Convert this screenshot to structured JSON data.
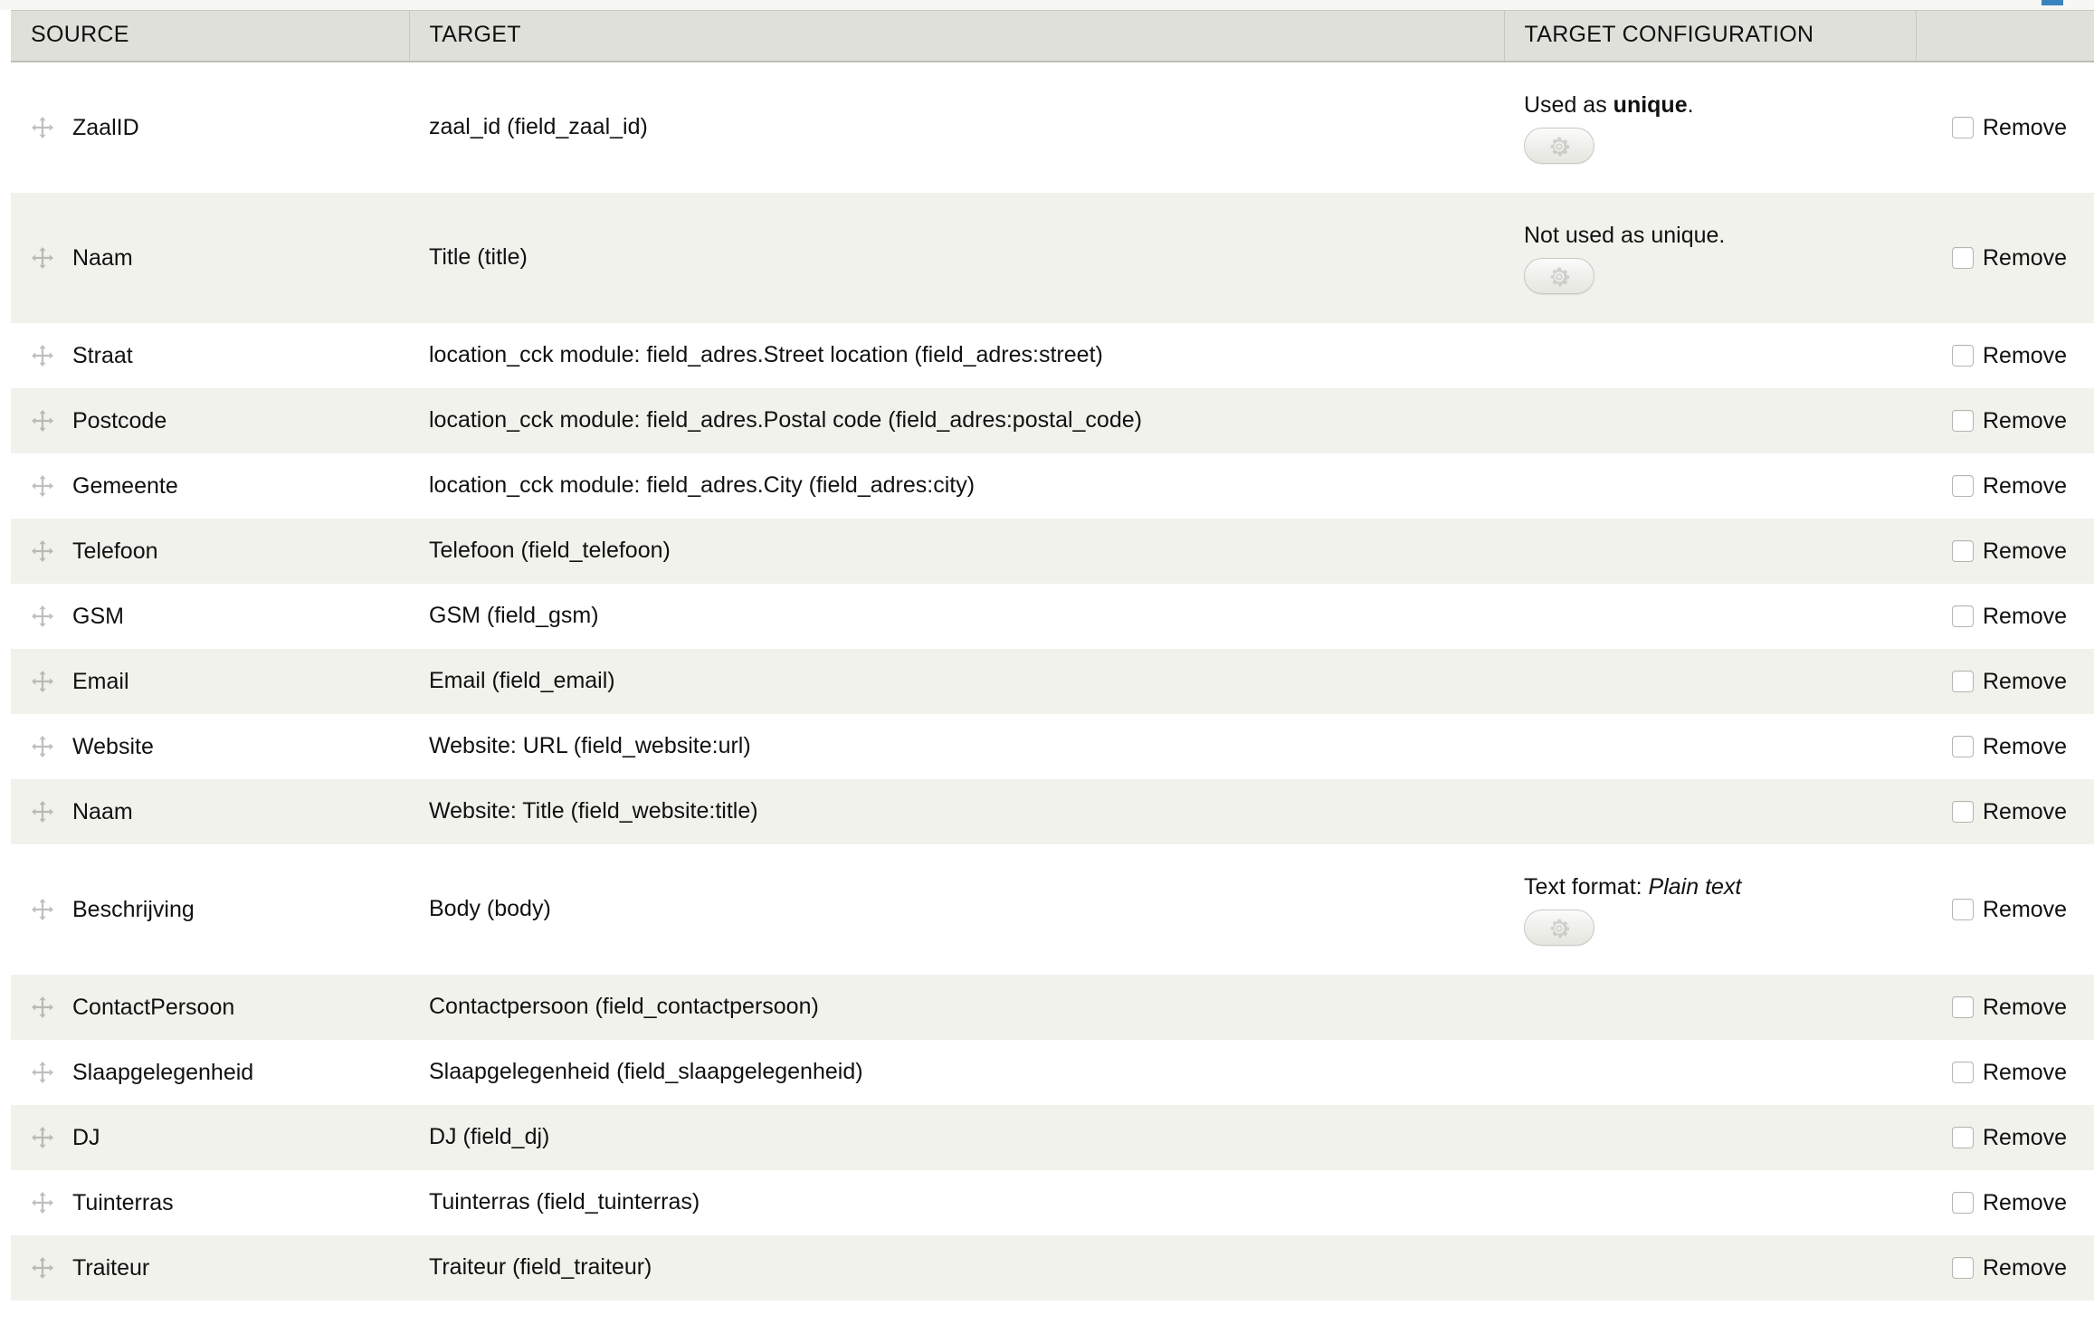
{
  "top_fragment_color": "#3a84bd",
  "table": {
    "headers": {
      "source": "SOURCE",
      "target": "TARGET",
      "target_configuration": "TARGET CONFIGURATION",
      "actions": ""
    },
    "remove_label": "Remove",
    "rows": [
      {
        "source": "ZaalID",
        "target": "zaal_id (field_zaal_id)",
        "config_prefix": "Used as ",
        "config_strong": "unique",
        "config_suffix": ".",
        "config_italic": "",
        "has_gear": true,
        "remove": "Remove",
        "tall": true
      },
      {
        "source": "Naam",
        "target": "Title (title)",
        "config_prefix": "Not used as unique.",
        "config_strong": "",
        "config_suffix": "",
        "config_italic": "",
        "has_gear": true,
        "remove": "Remove",
        "tall": true
      },
      {
        "source": "Straat",
        "target": "location_cck module: field_adres.Street location (field_adres:street)",
        "config_prefix": "",
        "config_strong": "",
        "config_suffix": "",
        "config_italic": "",
        "has_gear": false,
        "remove": "Remove",
        "tall": false
      },
      {
        "source": "Postcode",
        "target": "location_cck module: field_adres.Postal code (field_adres:postal_code)",
        "config_prefix": "",
        "config_strong": "",
        "config_suffix": "",
        "config_italic": "",
        "has_gear": false,
        "remove": "Remove",
        "tall": false
      },
      {
        "source": "Gemeente",
        "target": "location_cck module: field_adres.City (field_adres:city)",
        "config_prefix": "",
        "config_strong": "",
        "config_suffix": "",
        "config_italic": "",
        "has_gear": false,
        "remove": "Remove",
        "tall": false
      },
      {
        "source": "Telefoon",
        "target": "Telefoon (field_telefoon)",
        "config_prefix": "",
        "config_strong": "",
        "config_suffix": "",
        "config_italic": "",
        "has_gear": false,
        "remove": "Remove",
        "tall": false
      },
      {
        "source": "GSM",
        "target": "GSM (field_gsm)",
        "config_prefix": "",
        "config_strong": "",
        "config_suffix": "",
        "config_italic": "",
        "has_gear": false,
        "remove": "Remove",
        "tall": false
      },
      {
        "source": "Email",
        "target": "Email (field_email)",
        "config_prefix": "",
        "config_strong": "",
        "config_suffix": "",
        "config_italic": "",
        "has_gear": false,
        "remove": "Remove",
        "tall": false
      },
      {
        "source": "Website",
        "target": "Website: URL (field_website:url)",
        "config_prefix": "",
        "config_strong": "",
        "config_suffix": "",
        "config_italic": "",
        "has_gear": false,
        "remove": "Remove",
        "tall": false
      },
      {
        "source": "Naam",
        "target": "Website: Title (field_website:title)",
        "config_prefix": "",
        "config_strong": "",
        "config_suffix": "",
        "config_italic": "",
        "has_gear": false,
        "remove": "Remove",
        "tall": false
      },
      {
        "source": "Beschrijving",
        "target": "Body (body)",
        "config_prefix": "Text format: ",
        "config_strong": "",
        "config_suffix": "",
        "config_italic": "Plain text",
        "has_gear": true,
        "remove": "Remove",
        "tall": true
      },
      {
        "source": "ContactPersoon",
        "target": "Contactpersoon (field_contactpersoon)",
        "config_prefix": "",
        "config_strong": "",
        "config_suffix": "",
        "config_italic": "",
        "has_gear": false,
        "remove": "Remove",
        "tall": false
      },
      {
        "source": "Slaapgelegenheid",
        "target": "Slaapgelegenheid (field_slaapgelegenheid)",
        "config_prefix": "",
        "config_strong": "",
        "config_suffix": "",
        "config_italic": "",
        "has_gear": false,
        "remove": "Remove",
        "tall": false
      },
      {
        "source": "DJ",
        "target": "DJ (field_dj)",
        "config_prefix": "",
        "config_strong": "",
        "config_suffix": "",
        "config_italic": "",
        "has_gear": false,
        "remove": "Remove",
        "tall": false
      },
      {
        "source": "Tuinterras",
        "target": "Tuinterras (field_tuinterras)",
        "config_prefix": "",
        "config_strong": "",
        "config_suffix": "",
        "config_italic": "",
        "has_gear": false,
        "remove": "Remove",
        "tall": false
      },
      {
        "source": "Traiteur",
        "target": "Traiteur (field_traiteur)",
        "config_prefix": "",
        "config_strong": "",
        "config_suffix": "",
        "config_italic": "",
        "has_gear": false,
        "remove": "Remove",
        "tall": false
      }
    ]
  }
}
